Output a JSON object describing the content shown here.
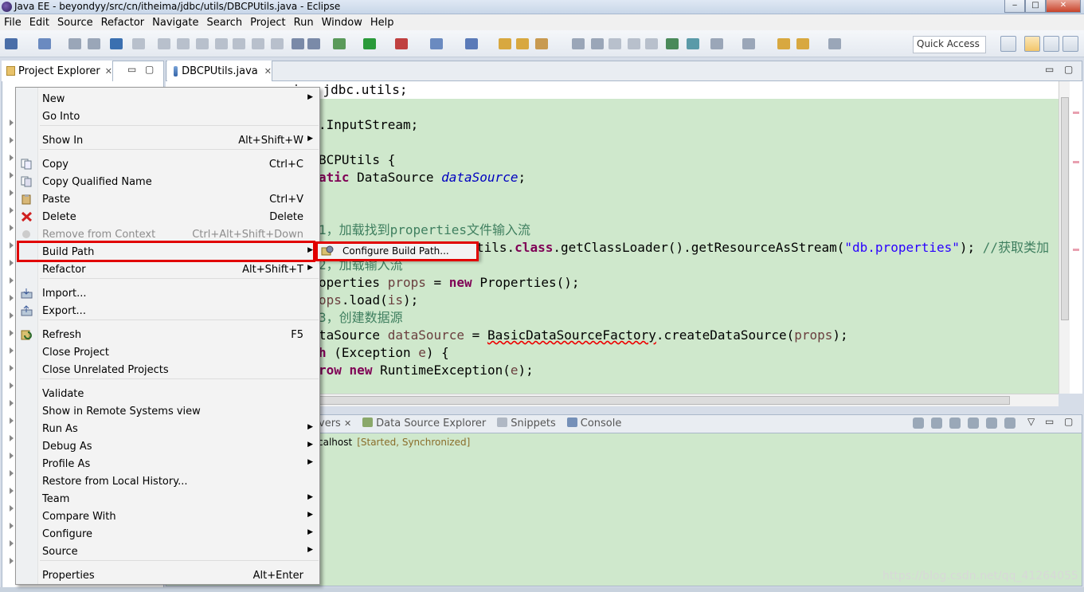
{
  "window": {
    "title": "Java EE - beyondyy/src/cn/itheima/jdbc/utils/DBCPUtils.java - Eclipse",
    "min": "‒",
    "max": "□",
    "close": "✕"
  },
  "menubar": [
    "File",
    "Edit",
    "Source",
    "Refactor",
    "Navigate",
    "Search",
    "Project",
    "Run",
    "Window",
    "Help"
  ],
  "toolbar": {
    "quick_access": "Quick Access"
  },
  "project_explorer": {
    "tab": "Project Explorer",
    "close": "✕"
  },
  "editor": {
    "tab": "DBCPUtils.java",
    "close": "✕",
    "lines": [
      {
        "parts": [
          {
            "t": "ima.jdbc.utils;",
            "c": ""
          }
        ]
      },
      {
        "parts": [
          {
            "t": ".InputStream;",
            "c": ""
          }
        ]
      },
      {
        "parts": [
          {
            "t": "BCPUtils {",
            "c": ""
          }
        ]
      },
      {
        "parts": [
          {
            "t": "atic",
            "c": "kw"
          },
          {
            "t": " DataSource ",
            "c": ""
          },
          {
            "t": "dataSource",
            "c": "it"
          },
          {
            "t": ";",
            "c": ""
          }
        ]
      },
      {
        "parts": [
          {
            "t": "1，加载找到properties文件输入流",
            "c": "cm"
          }
        ]
      },
      {
        "parts": [
          {
            "t": "tils.",
            "c": ""
          },
          {
            "t": "class",
            "c": "kw"
          },
          {
            "t": ".getClassLoader().getResourceAsStream(",
            "c": ""
          },
          {
            "t": "\"db.properties\"",
            "c": "str"
          },
          {
            "t": "); ",
            "c": ""
          },
          {
            "t": "//获取类加",
            "c": "cm"
          }
        ]
      },
      {
        "parts": [
          {
            "t": "2，加载输入流",
            "c": "cm"
          }
        ]
      },
      {
        "parts": [
          {
            "t": "operties ",
            "c": ""
          },
          {
            "t": "props",
            "c": "vr"
          },
          {
            "t": " = ",
            "c": ""
          },
          {
            "t": "new",
            "c": "kw"
          },
          {
            "t": " Properties();",
            "c": ""
          }
        ]
      },
      {
        "parts": [
          {
            "t": "ops",
            "c": "vr"
          },
          {
            "t": ".load(",
            "c": ""
          },
          {
            "t": "is",
            "c": "vr"
          },
          {
            "t": ");",
            "c": ""
          }
        ]
      },
      {
        "parts": [
          {
            "t": "3，创建数据源",
            "c": "cm"
          }
        ]
      },
      {
        "parts": [
          {
            "t": "taSource ",
            "c": ""
          },
          {
            "t": "dataSource",
            "c": "vr"
          },
          {
            "t": " = ",
            "c": ""
          },
          {
            "t": "BasicDataSourceFactory",
            "c": "sq"
          },
          {
            "t": ".createDataSource(",
            "c": ""
          },
          {
            "t": "props",
            "c": "vr"
          },
          {
            "t": ");",
            "c": ""
          }
        ]
      },
      {
        "parts": [
          {
            "t": "h",
            "c": "kw"
          },
          {
            "t": " (Exception ",
            "c": ""
          },
          {
            "t": "e",
            "c": "vr"
          },
          {
            "t": ") {",
            "c": ""
          }
        ]
      },
      {
        "parts": [
          {
            "t": "row",
            "c": "kw"
          },
          {
            "t": " ",
            "c": ""
          },
          {
            "t": "new",
            "c": "kw"
          },
          {
            "t": " RuntimeException(",
            "c": ""
          },
          {
            "t": "e",
            "c": "vr"
          },
          {
            "t": ");",
            "c": ""
          }
        ]
      }
    ]
  },
  "bottom_panel": {
    "tabs": [
      "vers",
      "Data Source Explorer",
      "Snippets",
      "Console"
    ],
    "tab_close": "✕",
    "server": "calhost",
    "server_state": "[Started, Synchronized]"
  },
  "context_menu": {
    "items": [
      {
        "label": "New",
        "shortcut": "",
        "submenu": true,
        "icon": "",
        "disabled": false
      },
      {
        "label": "Go Into",
        "shortcut": "",
        "submenu": false,
        "icon": "",
        "disabled": false
      },
      {
        "label": "Show In",
        "shortcut": "Alt+Shift+W",
        "submenu": true,
        "icon": "",
        "disabled": false
      },
      {
        "label": "Copy",
        "shortcut": "Ctrl+C",
        "submenu": false,
        "icon": "copy-icon",
        "disabled": false
      },
      {
        "label": "Copy Qualified Name",
        "shortcut": "",
        "submenu": false,
        "icon": "copy-qualified-icon",
        "disabled": false
      },
      {
        "label": "Paste",
        "shortcut": "Ctrl+V",
        "submenu": false,
        "icon": "paste-icon",
        "disabled": false
      },
      {
        "label": "Delete",
        "shortcut": "Delete",
        "submenu": false,
        "icon": "delete-icon",
        "disabled": false
      },
      {
        "label": "Remove from Context",
        "shortcut": "Ctrl+Alt+Shift+Down",
        "submenu": false,
        "icon": "remove-context-icon",
        "disabled": true
      },
      {
        "label": "Build Path",
        "shortcut": "",
        "submenu": true,
        "icon": "",
        "disabled": false
      },
      {
        "label": "Refactor",
        "shortcut": "Alt+Shift+T",
        "submenu": true,
        "icon": "",
        "disabled": false
      },
      {
        "label": "Import...",
        "shortcut": "",
        "submenu": false,
        "icon": "import-icon",
        "disabled": false
      },
      {
        "label": "Export...",
        "shortcut": "",
        "submenu": false,
        "icon": "export-icon",
        "disabled": false
      },
      {
        "label": "Refresh",
        "shortcut": "F5",
        "submenu": false,
        "icon": "refresh-icon",
        "disabled": false
      },
      {
        "label": "Close Project",
        "shortcut": "",
        "submenu": false,
        "icon": "",
        "disabled": false
      },
      {
        "label": "Close Unrelated Projects",
        "shortcut": "",
        "submenu": false,
        "icon": "",
        "disabled": false
      },
      {
        "label": "Validate",
        "shortcut": "",
        "submenu": false,
        "icon": "",
        "disabled": false
      },
      {
        "label": "Show in Remote Systems view",
        "shortcut": "",
        "submenu": false,
        "icon": "",
        "disabled": false
      },
      {
        "label": "Run As",
        "shortcut": "",
        "submenu": true,
        "icon": "",
        "disabled": false
      },
      {
        "label": "Debug As",
        "shortcut": "",
        "submenu": true,
        "icon": "",
        "disabled": false
      },
      {
        "label": "Profile As",
        "shortcut": "",
        "submenu": true,
        "icon": "",
        "disabled": false
      },
      {
        "label": "Restore from Local History...",
        "shortcut": "",
        "submenu": false,
        "icon": "",
        "disabled": false
      },
      {
        "label": "Team",
        "shortcut": "",
        "submenu": true,
        "icon": "",
        "disabled": false
      },
      {
        "label": "Compare With",
        "shortcut": "",
        "submenu": true,
        "icon": "",
        "disabled": false
      },
      {
        "label": "Configure",
        "shortcut": "",
        "submenu": true,
        "icon": "",
        "disabled": false
      },
      {
        "label": "Source",
        "shortcut": "",
        "submenu": true,
        "icon": "",
        "disabled": false
      },
      {
        "label": "Properties",
        "shortcut": "Alt+Enter",
        "submenu": false,
        "icon": "",
        "disabled": false
      }
    ],
    "arrow": "▶"
  },
  "submenu": {
    "label": "Configure Build Path..."
  },
  "watermark": "https://blog.csdn.net/qq_41264055",
  "colors": {
    "highlight_box": "#e10000",
    "editor_bg": "#cfe8cc"
  }
}
